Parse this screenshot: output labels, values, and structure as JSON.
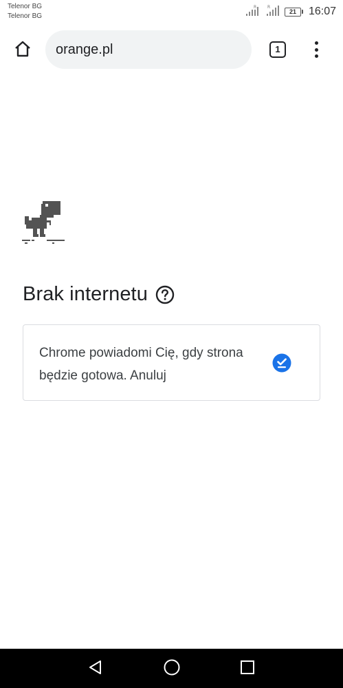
{
  "status_bar": {
    "carrier_1": "Telenor BG",
    "carrier_2": "Telenor BG",
    "signal_1_icon": "signal-icon",
    "signal_2_icon": "signal-icon",
    "battery_level": "21",
    "time": "16:07"
  },
  "toolbar": {
    "home_icon": "home-icon",
    "url": "orange.pl",
    "tab_count": "1",
    "menu_icon": "more-vert-icon"
  },
  "content": {
    "dino_icon": "offline-dino-icon",
    "headline": "Brak internetu",
    "help_icon": "help-circle-icon",
    "notify_message": "Chrome powiadomi Cię, gdy strona będzie gotowa. Anuluj",
    "check_icon": "check-circle-icon"
  },
  "nav_bar": {
    "back_icon": "back-triangle-icon",
    "home_icon": "home-circle-icon",
    "recents_icon": "recents-square-icon"
  },
  "colors": {
    "accent": "#1a73e8",
    "text": "#202124",
    "omnibox_bg": "#f1f3f4",
    "nav_bar_bg": "#000000"
  }
}
